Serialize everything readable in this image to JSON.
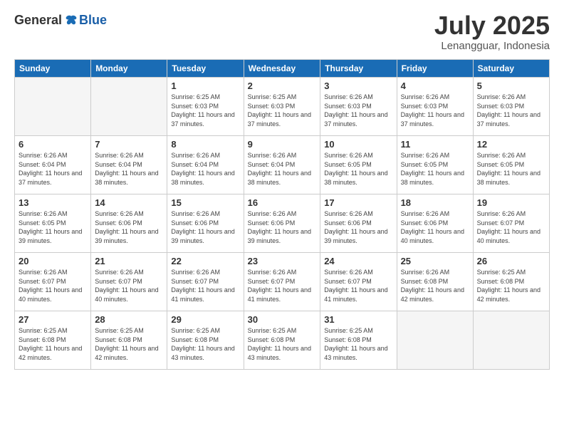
{
  "logo": {
    "general": "General",
    "blue": "Blue"
  },
  "title": "July 2025",
  "location": "Lenangguar, Indonesia",
  "days_header": [
    "Sunday",
    "Monday",
    "Tuesday",
    "Wednesday",
    "Thursday",
    "Friday",
    "Saturday"
  ],
  "weeks": [
    [
      {
        "day": "",
        "info": ""
      },
      {
        "day": "",
        "info": ""
      },
      {
        "day": "1",
        "info": "Sunrise: 6:25 AM\nSunset: 6:03 PM\nDaylight: 11 hours and 37 minutes."
      },
      {
        "day": "2",
        "info": "Sunrise: 6:25 AM\nSunset: 6:03 PM\nDaylight: 11 hours and 37 minutes."
      },
      {
        "day": "3",
        "info": "Sunrise: 6:26 AM\nSunset: 6:03 PM\nDaylight: 11 hours and 37 minutes."
      },
      {
        "day": "4",
        "info": "Sunrise: 6:26 AM\nSunset: 6:03 PM\nDaylight: 11 hours and 37 minutes."
      },
      {
        "day": "5",
        "info": "Sunrise: 6:26 AM\nSunset: 6:03 PM\nDaylight: 11 hours and 37 minutes."
      }
    ],
    [
      {
        "day": "6",
        "info": "Sunrise: 6:26 AM\nSunset: 6:04 PM\nDaylight: 11 hours and 37 minutes."
      },
      {
        "day": "7",
        "info": "Sunrise: 6:26 AM\nSunset: 6:04 PM\nDaylight: 11 hours and 38 minutes."
      },
      {
        "day": "8",
        "info": "Sunrise: 6:26 AM\nSunset: 6:04 PM\nDaylight: 11 hours and 38 minutes."
      },
      {
        "day": "9",
        "info": "Sunrise: 6:26 AM\nSunset: 6:04 PM\nDaylight: 11 hours and 38 minutes."
      },
      {
        "day": "10",
        "info": "Sunrise: 6:26 AM\nSunset: 6:05 PM\nDaylight: 11 hours and 38 minutes."
      },
      {
        "day": "11",
        "info": "Sunrise: 6:26 AM\nSunset: 6:05 PM\nDaylight: 11 hours and 38 minutes."
      },
      {
        "day": "12",
        "info": "Sunrise: 6:26 AM\nSunset: 6:05 PM\nDaylight: 11 hours and 38 minutes."
      }
    ],
    [
      {
        "day": "13",
        "info": "Sunrise: 6:26 AM\nSunset: 6:05 PM\nDaylight: 11 hours and 39 minutes."
      },
      {
        "day": "14",
        "info": "Sunrise: 6:26 AM\nSunset: 6:06 PM\nDaylight: 11 hours and 39 minutes."
      },
      {
        "day": "15",
        "info": "Sunrise: 6:26 AM\nSunset: 6:06 PM\nDaylight: 11 hours and 39 minutes."
      },
      {
        "day": "16",
        "info": "Sunrise: 6:26 AM\nSunset: 6:06 PM\nDaylight: 11 hours and 39 minutes."
      },
      {
        "day": "17",
        "info": "Sunrise: 6:26 AM\nSunset: 6:06 PM\nDaylight: 11 hours and 39 minutes."
      },
      {
        "day": "18",
        "info": "Sunrise: 6:26 AM\nSunset: 6:06 PM\nDaylight: 11 hours and 40 minutes."
      },
      {
        "day": "19",
        "info": "Sunrise: 6:26 AM\nSunset: 6:07 PM\nDaylight: 11 hours and 40 minutes."
      }
    ],
    [
      {
        "day": "20",
        "info": "Sunrise: 6:26 AM\nSunset: 6:07 PM\nDaylight: 11 hours and 40 minutes."
      },
      {
        "day": "21",
        "info": "Sunrise: 6:26 AM\nSunset: 6:07 PM\nDaylight: 11 hours and 40 minutes."
      },
      {
        "day": "22",
        "info": "Sunrise: 6:26 AM\nSunset: 6:07 PM\nDaylight: 11 hours and 41 minutes."
      },
      {
        "day": "23",
        "info": "Sunrise: 6:26 AM\nSunset: 6:07 PM\nDaylight: 11 hours and 41 minutes."
      },
      {
        "day": "24",
        "info": "Sunrise: 6:26 AM\nSunset: 6:07 PM\nDaylight: 11 hours and 41 minutes."
      },
      {
        "day": "25",
        "info": "Sunrise: 6:26 AM\nSunset: 6:08 PM\nDaylight: 11 hours and 42 minutes."
      },
      {
        "day": "26",
        "info": "Sunrise: 6:25 AM\nSunset: 6:08 PM\nDaylight: 11 hours and 42 minutes."
      }
    ],
    [
      {
        "day": "27",
        "info": "Sunrise: 6:25 AM\nSunset: 6:08 PM\nDaylight: 11 hours and 42 minutes."
      },
      {
        "day": "28",
        "info": "Sunrise: 6:25 AM\nSunset: 6:08 PM\nDaylight: 11 hours and 42 minutes."
      },
      {
        "day": "29",
        "info": "Sunrise: 6:25 AM\nSunset: 6:08 PM\nDaylight: 11 hours and 43 minutes."
      },
      {
        "day": "30",
        "info": "Sunrise: 6:25 AM\nSunset: 6:08 PM\nDaylight: 11 hours and 43 minutes."
      },
      {
        "day": "31",
        "info": "Sunrise: 6:25 AM\nSunset: 6:08 PM\nDaylight: 11 hours and 43 minutes."
      },
      {
        "day": "",
        "info": ""
      },
      {
        "day": "",
        "info": ""
      }
    ]
  ]
}
